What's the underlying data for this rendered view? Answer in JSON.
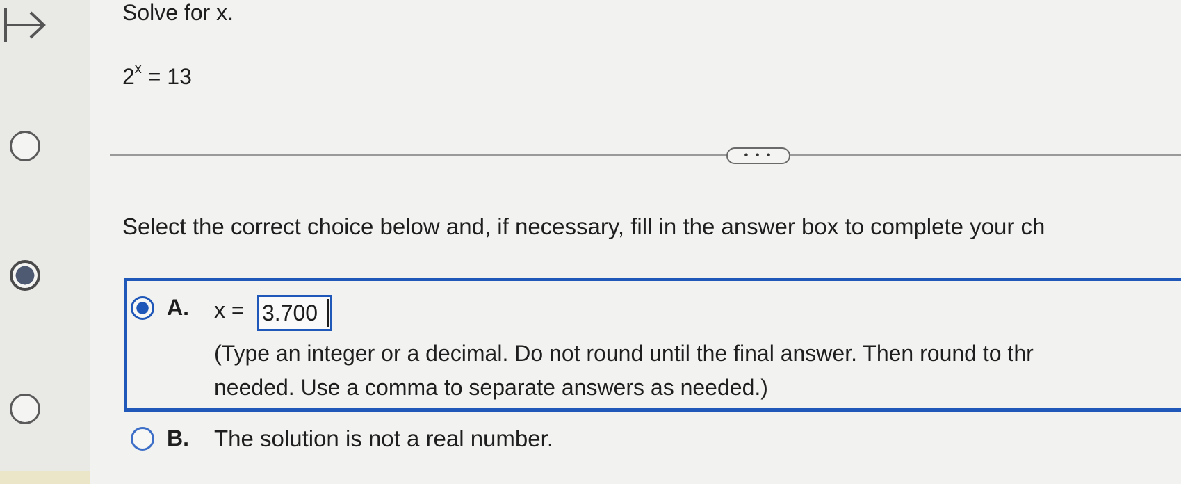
{
  "question": {
    "title": "Solve for x.",
    "equation_base": "2",
    "equation_exponent": "x",
    "equation_rhs": " = 13"
  },
  "more_button": {
    "label": "• • •"
  },
  "instruction": "Select the correct choice below and, if necessary, fill in the answer box to complete your ch",
  "choices": {
    "a": {
      "letter": "A.",
      "prefix": "x =",
      "answer_value": "3.700",
      "hint_line1": "(Type an integer or a decimal. Do not round until the final answer. Then round to thr",
      "hint_line2": "needed. Use a comma to separate answers as needed.)",
      "selected": true
    },
    "b": {
      "letter": "B.",
      "text": "The solution is not a real number.",
      "selected": false
    }
  },
  "sidebar": {
    "icons": [
      "arrow-right-icon",
      "radio-empty-icon",
      "radio-selected-icon",
      "radio-empty-icon"
    ]
  },
  "colors": {
    "accent": "#1f58b8",
    "background": "#f2f2f0"
  }
}
